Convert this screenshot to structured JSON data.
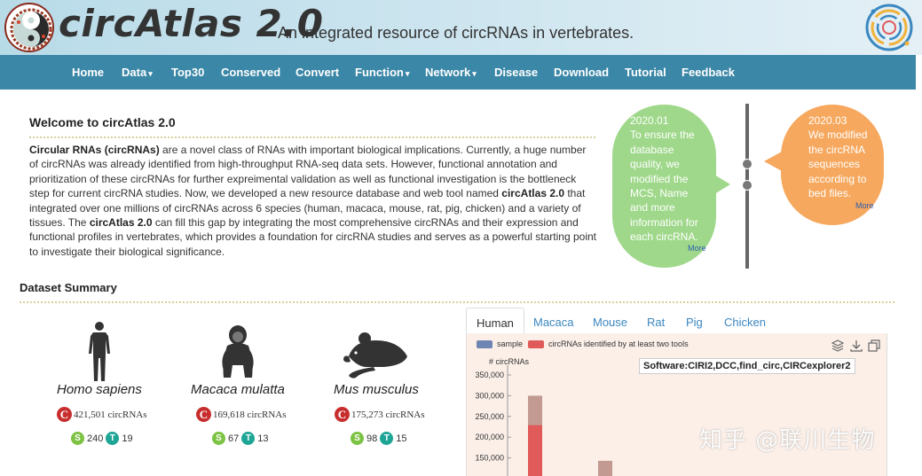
{
  "header": {
    "brand": "circAtlas 2.0",
    "tagline": "An integrated resource of circRNAs in vertebrates."
  },
  "nav": {
    "items": [
      {
        "label": "Home",
        "dropdown": false
      },
      {
        "label": "Data",
        "dropdown": true
      },
      {
        "label": "Top30",
        "dropdown": false
      },
      {
        "label": "Conserved",
        "dropdown": false
      },
      {
        "label": "Convert",
        "dropdown": false
      },
      {
        "label": "Function",
        "dropdown": true
      },
      {
        "label": "Network",
        "dropdown": true
      },
      {
        "label": "Disease",
        "dropdown": false
      },
      {
        "label": "Download",
        "dropdown": false
      },
      {
        "label": "Tutorial",
        "dropdown": false
      },
      {
        "label": "Feedback",
        "dropdown": false
      }
    ],
    "caret": "▾"
  },
  "welcome": {
    "title": "Welcome to circAtlas 2.0",
    "p1_bold": "Circular RNAs (circRNAs)",
    "p1": " are a novel class of RNAs with important biological implications. Currently, a huge number of circRNAs was already identified from high-throughput RNA-seq data sets. However, functional annotation and prioritization of these circRNAs for further expreimental validation as well as functional investigation is the bottleneck step for current circRNA studies. Now, we developed a new resource database and web tool named ",
    "p2_bold": "circAtlas 2.0",
    "p2": " that integrated over one millions of circRNAs across 6 species (human, macaca, mouse, rat, pig, chicken) and a variety of tissues. The ",
    "p3_bold": "circAtlas 2.0",
    "p3": " can fill this gap by integrating the most comprehensive circRNAs and their expression and functional profiles in vertebrates, which provides a foundation for circRNA studies and serves as a powerful starting point to investigate their biological significance."
  },
  "news": [
    {
      "date": "2020.01",
      "text": "To ensure the database quality, we modified the MCS, Name and more information for each circRNA.",
      "more": "More",
      "color": "#9fd88a"
    },
    {
      "date": "2020.03",
      "text": "We modified the circRNA sequences according to bed files.",
      "more": "More",
      "color": "#f6a85e"
    }
  ],
  "dataset": {
    "title": "Dataset Summary",
    "species": [
      {
        "name": "Homo sapiens",
        "circ_count": "421,501 circRNAs",
        "s": "240",
        "t": "19",
        "icon": "human-silhouette-icon"
      },
      {
        "name": "Macaca mulatta",
        "circ_count": "169,618 circRNAs",
        "s": "67",
        "t": "13",
        "icon": "monkey-silhouette-icon"
      },
      {
        "name": "Mus musculus",
        "circ_count": "175,273 circRNAs",
        "s": "98",
        "t": "15",
        "icon": "mouse-silhouette-icon"
      }
    ],
    "badges": {
      "c": "C",
      "s": "S",
      "t": "T"
    }
  },
  "chart_tabs": [
    "Human",
    "Macaca",
    "Mouse",
    "Rat",
    "Pig",
    "Chicken"
  ],
  "chart_tabs_active": "Human",
  "chart_data": {
    "type": "bar",
    "ylabel": "# circRNAs",
    "y_ticks": [
      "350,000",
      "300,000",
      "250,000",
      "200,000",
      "150,000"
    ],
    "ylim": [
      100000,
      350000
    ],
    "series": [
      {
        "name": "sample",
        "color": "#6f86b3",
        "values": [
          300000,
          143000
        ]
      },
      {
        "name": "circRNAs identified by at least two tools",
        "color": "#e05a5a",
        "values": [
          229000,
          0
        ]
      }
    ],
    "tooltip": "Software:CIRI2,DCC,find_circ,CIRCexplorer2"
  },
  "watermark": "知乎 @联川生物",
  "colors": {
    "navbar": "#3b87a7",
    "accent": "#3b87c0",
    "panel": "#fbefe8"
  }
}
